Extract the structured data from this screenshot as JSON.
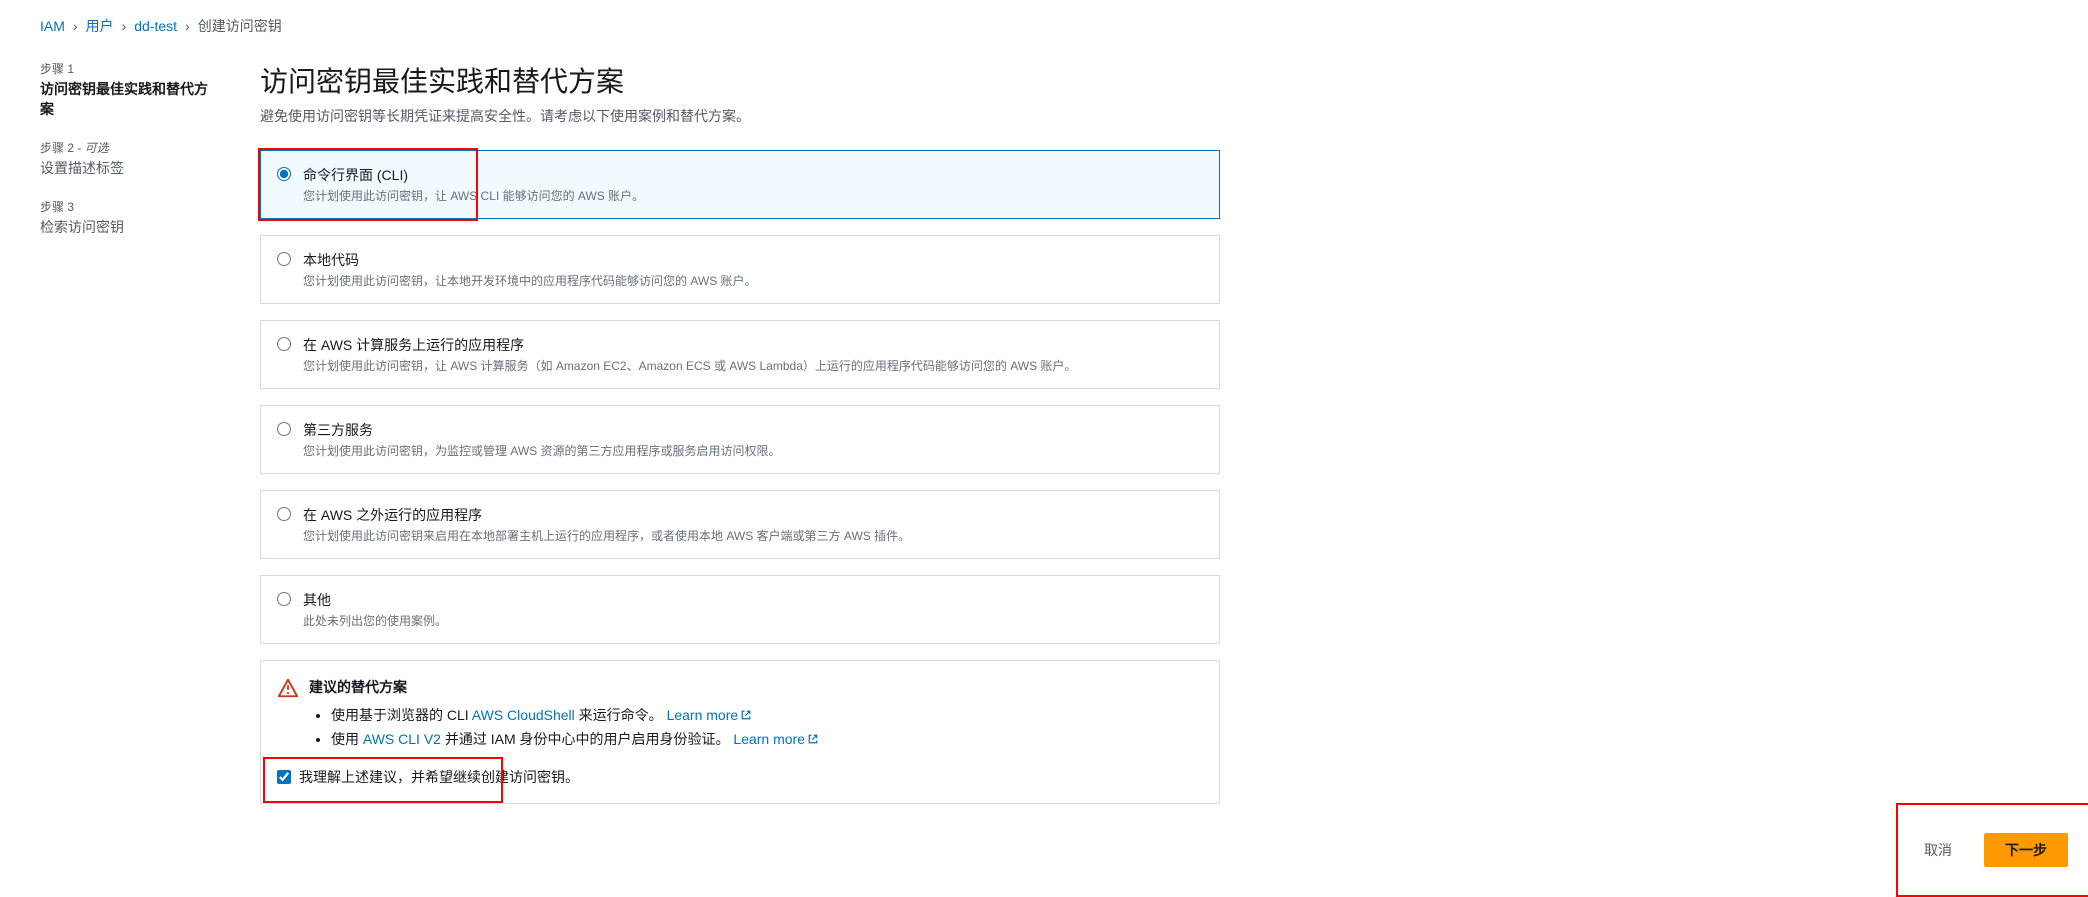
{
  "breadcrumb": {
    "iam": "IAM",
    "users": "用户",
    "user": "dd-test",
    "current": "创建访问密钥"
  },
  "sidebar": {
    "steps": [
      {
        "label": "步骤 1",
        "title": "访问密钥最佳实践和替代方案",
        "optional": ""
      },
      {
        "label": "步骤 2",
        "title": "设置描述标签",
        "optional": " - 可选"
      },
      {
        "label": "步骤 3",
        "title": "检索访问密钥",
        "optional": ""
      }
    ]
  },
  "header": {
    "title": "访问密钥最佳实践和替代方案",
    "subtitle": "避免使用访问密钥等长期凭证来提高安全性。请考虑以下使用案例和替代方案。"
  },
  "options": [
    {
      "title": "命令行界面 (CLI)",
      "desc": "您计划使用此访问密钥，让 AWS CLI 能够访问您的 AWS 账户。",
      "selected": true
    },
    {
      "title": "本地代码",
      "desc": "您计划使用此访问密钥，让本地开发环境中的应用程序代码能够访问您的 AWS 账户。",
      "selected": false
    },
    {
      "title": "在 AWS 计算服务上运行的应用程序",
      "desc": "您计划使用此访问密钥，让 AWS 计算服务（如 Amazon EC2、Amazon ECS 或 AWS Lambda）上运行的应用程序代码能够访问您的 AWS 账户。",
      "selected": false
    },
    {
      "title": "第三方服务",
      "desc": "您计划使用此访问密钥，为监控或管理 AWS 资源的第三方应用程序或服务启用访问权限。",
      "selected": false
    },
    {
      "title": "在 AWS 之外运行的应用程序",
      "desc": "您计划使用此访问密钥来启用在本地部署主机上运行的应用程序，或者使用本地 AWS 客户端或第三方 AWS 插件。",
      "selected": false
    },
    {
      "title": "其他",
      "desc": "此处未列出您的使用案例。",
      "selected": false
    }
  ],
  "alternatives": {
    "heading": "建议的替代方案",
    "item1_prefix": "使用基于浏览器的 CLI ",
    "item1_link": "AWS CloudShell",
    "item1_suffix": " 来运行命令。 ",
    "item2_prefix": "使用 ",
    "item2_link": "AWS CLI V2",
    "item2_suffix": " 并通过 IAM 身份中心中的用户启用身份验证。 ",
    "learn_more": "Learn more"
  },
  "confirm": {
    "label": "我理解上述建议，并希望继续创建访问密钥。"
  },
  "actions": {
    "cancel": "取消",
    "next": "下一步"
  }
}
